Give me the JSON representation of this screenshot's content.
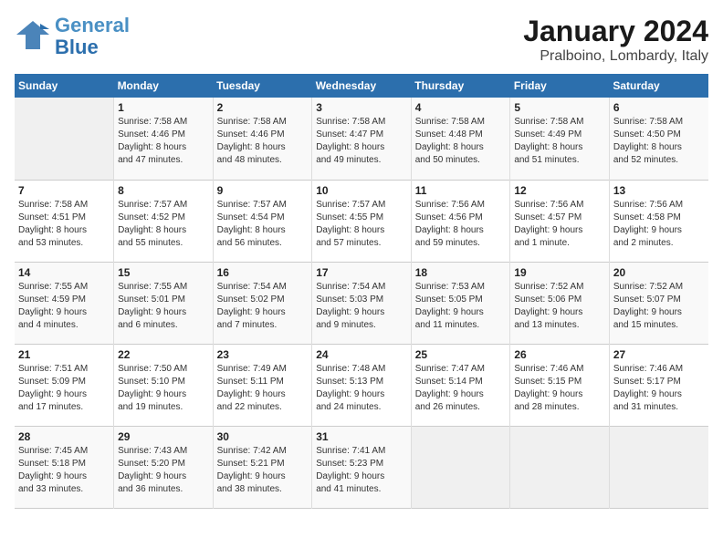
{
  "logo": {
    "text1": "General",
    "text2": "Blue"
  },
  "header": {
    "month": "January 2024",
    "location": "Pralboino, Lombardy, Italy"
  },
  "weekdays": [
    "Sunday",
    "Monday",
    "Tuesday",
    "Wednesday",
    "Thursday",
    "Friday",
    "Saturday"
  ],
  "weeks": [
    [
      {
        "day": "",
        "info": ""
      },
      {
        "day": "1",
        "info": "Sunrise: 7:58 AM\nSunset: 4:46 PM\nDaylight: 8 hours\nand 47 minutes."
      },
      {
        "day": "2",
        "info": "Sunrise: 7:58 AM\nSunset: 4:46 PM\nDaylight: 8 hours\nand 48 minutes."
      },
      {
        "day": "3",
        "info": "Sunrise: 7:58 AM\nSunset: 4:47 PM\nDaylight: 8 hours\nand 49 minutes."
      },
      {
        "day": "4",
        "info": "Sunrise: 7:58 AM\nSunset: 4:48 PM\nDaylight: 8 hours\nand 50 minutes."
      },
      {
        "day": "5",
        "info": "Sunrise: 7:58 AM\nSunset: 4:49 PM\nDaylight: 8 hours\nand 51 minutes."
      },
      {
        "day": "6",
        "info": "Sunrise: 7:58 AM\nSunset: 4:50 PM\nDaylight: 8 hours\nand 52 minutes."
      }
    ],
    [
      {
        "day": "7",
        "info": "Sunrise: 7:58 AM\nSunset: 4:51 PM\nDaylight: 8 hours\nand 53 minutes."
      },
      {
        "day": "8",
        "info": "Sunrise: 7:57 AM\nSunset: 4:52 PM\nDaylight: 8 hours\nand 55 minutes."
      },
      {
        "day": "9",
        "info": "Sunrise: 7:57 AM\nSunset: 4:54 PM\nDaylight: 8 hours\nand 56 minutes."
      },
      {
        "day": "10",
        "info": "Sunrise: 7:57 AM\nSunset: 4:55 PM\nDaylight: 8 hours\nand 57 minutes."
      },
      {
        "day": "11",
        "info": "Sunrise: 7:56 AM\nSunset: 4:56 PM\nDaylight: 8 hours\nand 59 minutes."
      },
      {
        "day": "12",
        "info": "Sunrise: 7:56 AM\nSunset: 4:57 PM\nDaylight: 9 hours\nand 1 minute."
      },
      {
        "day": "13",
        "info": "Sunrise: 7:56 AM\nSunset: 4:58 PM\nDaylight: 9 hours\nand 2 minutes."
      }
    ],
    [
      {
        "day": "14",
        "info": "Sunrise: 7:55 AM\nSunset: 4:59 PM\nDaylight: 9 hours\nand 4 minutes."
      },
      {
        "day": "15",
        "info": "Sunrise: 7:55 AM\nSunset: 5:01 PM\nDaylight: 9 hours\nand 6 minutes."
      },
      {
        "day": "16",
        "info": "Sunrise: 7:54 AM\nSunset: 5:02 PM\nDaylight: 9 hours\nand 7 minutes."
      },
      {
        "day": "17",
        "info": "Sunrise: 7:54 AM\nSunset: 5:03 PM\nDaylight: 9 hours\nand 9 minutes."
      },
      {
        "day": "18",
        "info": "Sunrise: 7:53 AM\nSunset: 5:05 PM\nDaylight: 9 hours\nand 11 minutes."
      },
      {
        "day": "19",
        "info": "Sunrise: 7:52 AM\nSunset: 5:06 PM\nDaylight: 9 hours\nand 13 minutes."
      },
      {
        "day": "20",
        "info": "Sunrise: 7:52 AM\nSunset: 5:07 PM\nDaylight: 9 hours\nand 15 minutes."
      }
    ],
    [
      {
        "day": "21",
        "info": "Sunrise: 7:51 AM\nSunset: 5:09 PM\nDaylight: 9 hours\nand 17 minutes."
      },
      {
        "day": "22",
        "info": "Sunrise: 7:50 AM\nSunset: 5:10 PM\nDaylight: 9 hours\nand 19 minutes."
      },
      {
        "day": "23",
        "info": "Sunrise: 7:49 AM\nSunset: 5:11 PM\nDaylight: 9 hours\nand 22 minutes."
      },
      {
        "day": "24",
        "info": "Sunrise: 7:48 AM\nSunset: 5:13 PM\nDaylight: 9 hours\nand 24 minutes."
      },
      {
        "day": "25",
        "info": "Sunrise: 7:47 AM\nSunset: 5:14 PM\nDaylight: 9 hours\nand 26 minutes."
      },
      {
        "day": "26",
        "info": "Sunrise: 7:46 AM\nSunset: 5:15 PM\nDaylight: 9 hours\nand 28 minutes."
      },
      {
        "day": "27",
        "info": "Sunrise: 7:46 AM\nSunset: 5:17 PM\nDaylight: 9 hours\nand 31 minutes."
      }
    ],
    [
      {
        "day": "28",
        "info": "Sunrise: 7:45 AM\nSunset: 5:18 PM\nDaylight: 9 hours\nand 33 minutes."
      },
      {
        "day": "29",
        "info": "Sunrise: 7:43 AM\nSunset: 5:20 PM\nDaylight: 9 hours\nand 36 minutes."
      },
      {
        "day": "30",
        "info": "Sunrise: 7:42 AM\nSunset: 5:21 PM\nDaylight: 9 hours\nand 38 minutes."
      },
      {
        "day": "31",
        "info": "Sunrise: 7:41 AM\nSunset: 5:23 PM\nDaylight: 9 hours\nand 41 minutes."
      },
      {
        "day": "",
        "info": ""
      },
      {
        "day": "",
        "info": ""
      },
      {
        "day": "",
        "info": ""
      }
    ]
  ]
}
